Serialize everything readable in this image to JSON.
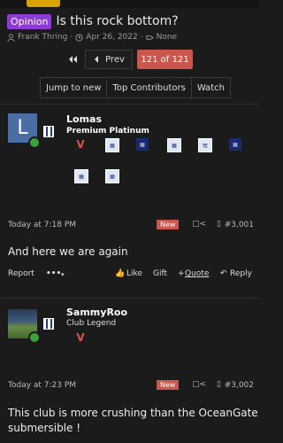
{
  "thread": {
    "badge": "Opinion",
    "title": "Is this rock bottom?",
    "author": "Frank Thring",
    "date": "Apr 26, 2022",
    "replies": "None"
  },
  "pager": {
    "prev_label": "Prev",
    "current": "121 of 121"
  },
  "tabs": [
    "Jump to new",
    "Top Contributors",
    "Watch"
  ],
  "posts": [
    {
      "avatar_letter": "L",
      "username": "Lomas",
      "user_title": "Premium Platinum",
      "date": "Today at 7:18 PM",
      "new_label": "New",
      "number": "#3,001",
      "body": "And here we are again"
    },
    {
      "username": "SammyRoo",
      "user_title": "Club Legend",
      "date": "Today at 7:23 PM",
      "new_label": "New",
      "number": "#3,002",
      "body_line1": "This club is more crushing than the OceanGate",
      "body_line2": "submersible !"
    }
  ],
  "actions": {
    "report": "Report",
    "more": "•••",
    "like": "Like",
    "gift": "Gift",
    "quote": "Quote",
    "reply": "Reply"
  },
  "colors": {
    "accent_red": "#c9574d",
    "opinion_purple": "#8e3bd6",
    "online_green": "#3ba13b"
  }
}
